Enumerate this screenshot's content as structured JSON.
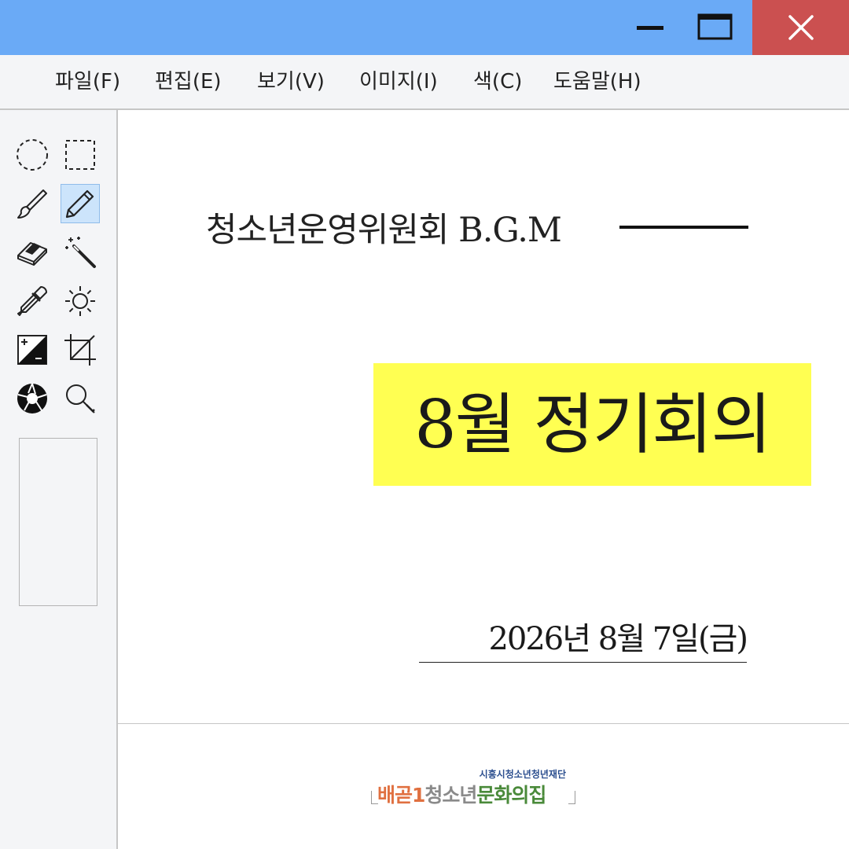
{
  "window": {
    "controls": {
      "minimize": "minimize-icon",
      "maximize": "maximize-icon",
      "close": "close-icon"
    }
  },
  "menu": {
    "items": [
      {
        "label": "파일(F)"
      },
      {
        "label": "편집(E)"
      },
      {
        "label": "보기(V)"
      },
      {
        "label": "이미지(I)"
      },
      {
        "label": "색(C)"
      },
      {
        "label": "도움말(H)"
      }
    ]
  },
  "toolbox": {
    "tools": [
      {
        "icon": "ellipse-select-icon"
      },
      {
        "icon": "rect-select-icon"
      },
      {
        "icon": "brush-icon"
      },
      {
        "icon": "pencil-icon",
        "active": true
      },
      {
        "icon": "eraser-icon"
      },
      {
        "icon": "magic-wand-icon"
      },
      {
        "icon": "eyedropper-icon"
      },
      {
        "icon": "brightness-icon"
      },
      {
        "icon": "contrast-icon"
      },
      {
        "icon": "crop-icon"
      },
      {
        "icon": "aperture-icon"
      },
      {
        "icon": "zoom-icon"
      }
    ]
  },
  "canvas": {
    "subtitle": "청소년운영위원회 B.G.M",
    "title": "8월 정기회의",
    "date": "2026년 8월 7일(금)",
    "highlight_color": "#ffff52"
  },
  "footer": {
    "org": "시흥시청소년청년재단",
    "logo": {
      "part1": "배곧1",
      "part2": "청소년",
      "part3": "문화의집"
    }
  },
  "colors": {
    "titlebar": "#6aaaf6",
    "close": "#cb5050",
    "active_tool": "#cce4fb"
  }
}
